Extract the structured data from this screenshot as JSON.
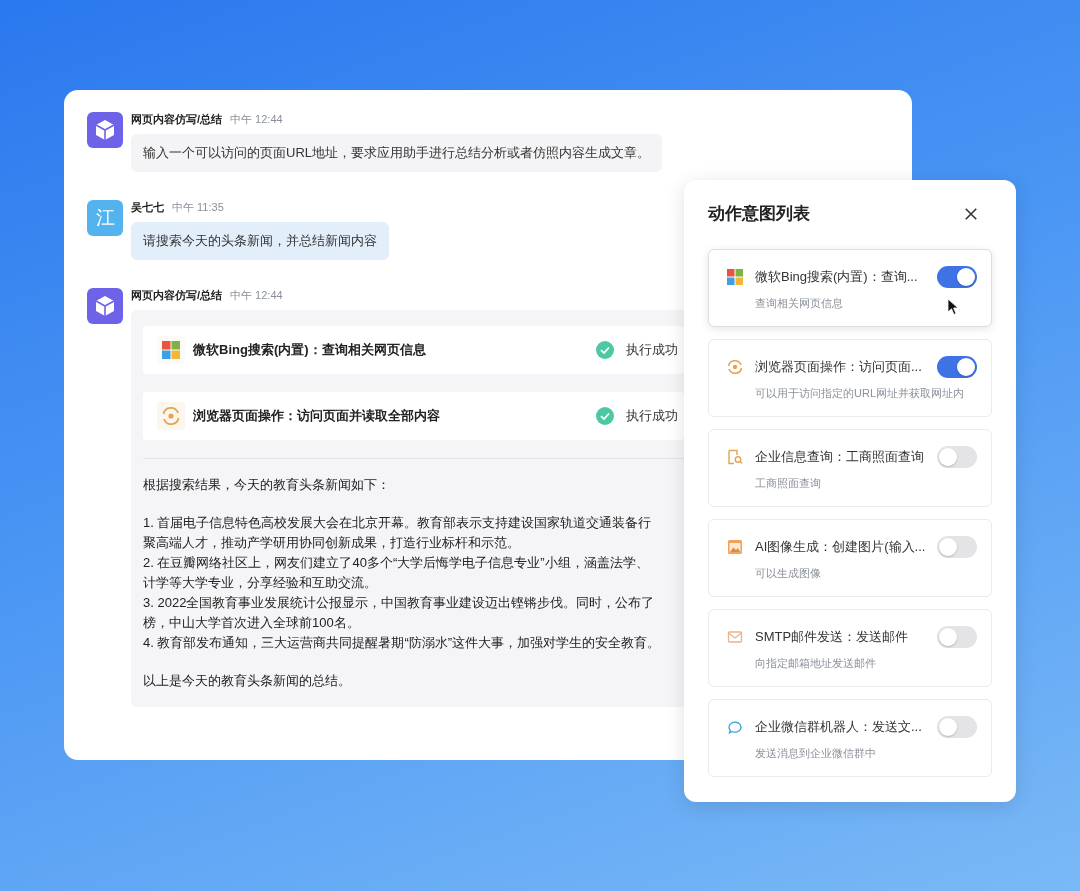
{
  "chat": {
    "messages": [
      {
        "kind": "bot",
        "author": "网页内容仿写/总结",
        "time": "中午 12:44",
        "text": "输入一个可以访问的页面URL地址，要求应用助手进行总结分析或者仿照内容生成文章。"
      },
      {
        "kind": "user",
        "avatar_text": "江",
        "author": "吴七七",
        "time": "中午 11:35",
        "text": "请搜索今天的头条新闻，并总结新闻内容"
      },
      {
        "kind": "result",
        "author": "网页内容仿写/总结",
        "time": "中午 12:44",
        "tools": [
          {
            "label": "微软Bing搜索(内置)：查询相关网页信息",
            "status": "执行成功"
          },
          {
            "label": "浏览器页面操作：访问页面并读取全部内容",
            "status": "执行成功"
          }
        ],
        "paragraphs": [
          [
            "根据搜索结果，今天的教育头条新闻如下："
          ],
          [
            "1. 首届电子信息特色高校发展大会在北京开幕。教育部表示支持建设国家轨道交通装备行",
            "聚高端人才，推动产学研用协同创新成果，打造行业标杆和示范。",
            "2. 在豆瓣网络社区上，网友们建立了40多个“大学后悔学电子信息专业”小组，涵盖法学、",
            "计学等大学专业，分享经验和互助交流。",
            "3. 2022全国教育事业发展统计公报显示，中国教育事业建设迈出铿锵步伐。同时，公布了",
            "榜，中山大学首次进入全球前100名。",
            "4. 教育部发布通知，三大运营商共同提醒暑期“防溺水”这件大事，加强对学生的安全教育。"
          ],
          [
            "以上是今天的教育头条新闻的总结。"
          ]
        ]
      }
    ]
  },
  "panel": {
    "title": "动作意图列表",
    "items": [
      {
        "title": "微软Bing搜索(内置)：查询...",
        "desc": "查询相关网页信息",
        "on": true,
        "selected": true
      },
      {
        "title": "浏览器页面操作：访问页面...",
        "desc": "可以用于访问指定的URL网址并获取网址内",
        "on": true,
        "selected": false
      },
      {
        "title": "企业信息查询：工商照面查询",
        "desc": "工商照面查询",
        "on": false,
        "selected": false
      },
      {
        "title": "AI图像生成：创建图片(输入...",
        "desc": "可以生成图像",
        "on": false,
        "selected": false
      },
      {
        "title": "SMTP邮件发送：发送邮件",
        "desc": "向指定邮箱地址发送邮件",
        "on": false,
        "selected": false
      },
      {
        "title": "企业微信群机器人：发送文...",
        "desc": "发送消息到企业微信群中",
        "on": false,
        "selected": false
      }
    ]
  }
}
